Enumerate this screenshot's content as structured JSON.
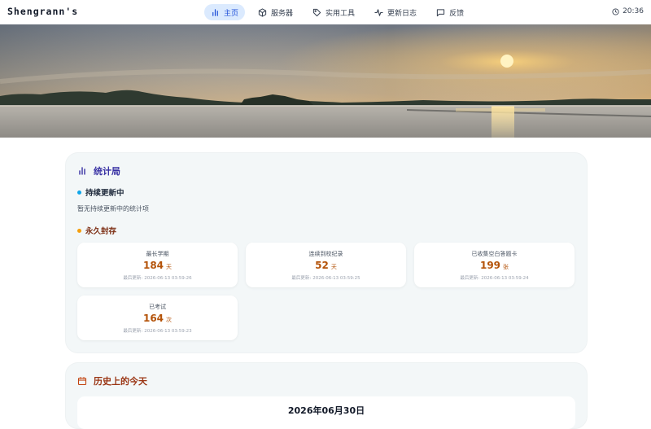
{
  "header": {
    "brand": "Shengrann's",
    "nav": [
      {
        "label": "主页",
        "icon": "bar-chart-icon",
        "active": true
      },
      {
        "label": "服务器",
        "icon": "box-icon",
        "active": false
      },
      {
        "label": "实用工具",
        "icon": "tag-icon",
        "active": false
      },
      {
        "label": "更新日志",
        "icon": "activity-icon",
        "active": false
      },
      {
        "label": "反馈",
        "icon": "message-icon",
        "active": false
      }
    ],
    "clock_icon": "clock-icon",
    "time": "20:36"
  },
  "hero": {
    "image": "lake-sunset-banner"
  },
  "stats_card": {
    "title": "统计局",
    "icon": "bar-chart-icon",
    "ongoing": {
      "title": "持续更新中",
      "empty_text": "暂无持续更新中的统计项"
    },
    "archived": {
      "title": "永久封存",
      "items": [
        {
          "label": "最长学期",
          "value": "184",
          "unit": "天",
          "updated_label": "最后更新:",
          "updated": "2026-06-13 03:59:26"
        },
        {
          "label": "连续到校纪录",
          "value": "52",
          "unit": "天",
          "updated_label": "最后更新:",
          "updated": "2026-06-13 03:59:25"
        },
        {
          "label": "已收集空白答题卡",
          "value": "199",
          "unit": "张",
          "updated_label": "最后更新:",
          "updated": "2026-06-13 03:59:24"
        },
        {
          "label": "已考试",
          "value": "164",
          "unit": "次",
          "updated_label": "最后更新:",
          "updated": "2026-06-13 03:59:23"
        }
      ]
    }
  },
  "history_card": {
    "title": "历史上的今天",
    "icon": "calendar-icon",
    "date": "2026年06月30日"
  },
  "colors": {
    "accent": "#1d4ed8",
    "nav_active_bg": "#dbeafe",
    "stat_value": "#b45309",
    "card_bg": "#f3f7f8",
    "stats_title": "#3730a3",
    "history_title": "#9a3412"
  }
}
